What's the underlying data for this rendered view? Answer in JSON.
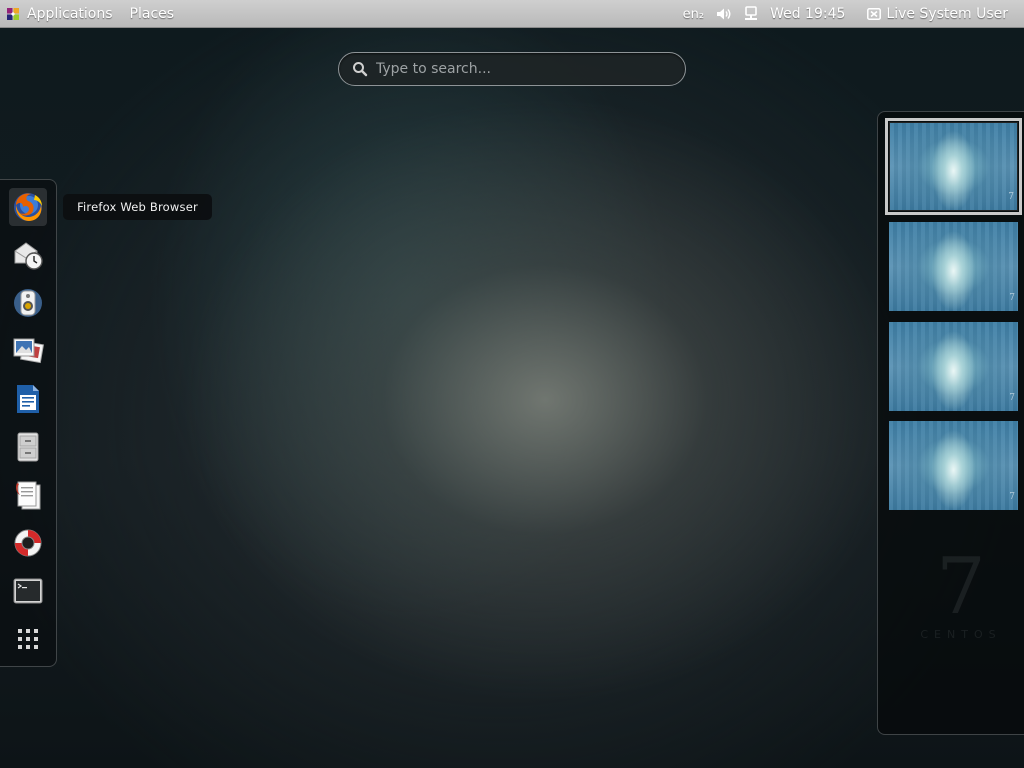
{
  "top_panel": {
    "applications_label": "Applications",
    "places_label": "Places",
    "keyboard_layout": "en₂",
    "clock": "Wed 19:45",
    "user_label": "Live System User"
  },
  "search": {
    "placeholder": "Type to search..."
  },
  "dash": {
    "items": [
      {
        "name": "firefox",
        "icon": "firefox-icon"
      },
      {
        "name": "evolution",
        "icon": "mail-clock-icon"
      },
      {
        "name": "rhythmbox",
        "icon": "speaker-icon"
      },
      {
        "name": "shotwell",
        "icon": "photos-icon"
      },
      {
        "name": "libreoffice-writer",
        "icon": "writer-document-icon"
      },
      {
        "name": "file-roller",
        "icon": "file-cabinet-icon"
      },
      {
        "name": "documents",
        "icon": "documents-icon"
      },
      {
        "name": "help",
        "icon": "lifebuoy-icon"
      },
      {
        "name": "terminal",
        "icon": "terminal-icon"
      },
      {
        "name": "show-applications",
        "icon": "grid-icon"
      }
    ],
    "active_index": 0
  },
  "tooltip": {
    "text": "Firefox Web Browser"
  },
  "workspaces": {
    "count": 4,
    "active_index": 0
  },
  "watermark": {
    "numeral": "7",
    "word": "CENTOS"
  },
  "colors": {
    "panel_bg": "#c4c4c4",
    "firefox_orange": "#e66000",
    "writer_blue": "#1f5fa8"
  }
}
